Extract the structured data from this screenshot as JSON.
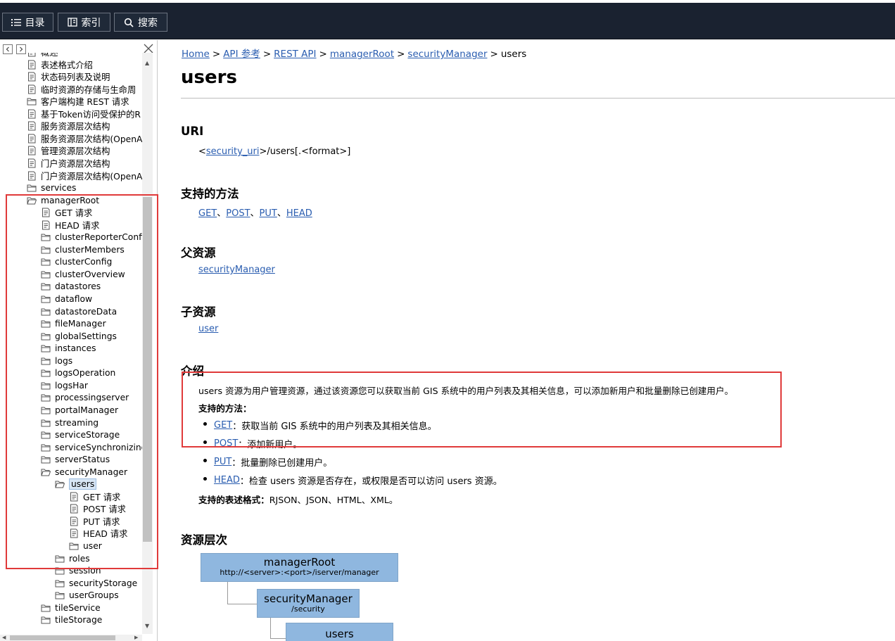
{
  "toolbar": {
    "buttons": [
      {
        "label": "目录",
        "icon": "list-icon"
      },
      {
        "label": "索引",
        "icon": "index-icon"
      },
      {
        "label": "搜索",
        "icon": "search-icon"
      }
    ]
  },
  "tree": {
    "items": [
      {
        "label": "概述",
        "type": "doc",
        "level": 0
      },
      {
        "label": "表述格式介绍",
        "type": "doc",
        "level": 0
      },
      {
        "label": "状态码列表及说明",
        "type": "doc",
        "level": 0
      },
      {
        "label": "临时资源的存储与生命周",
        "type": "doc",
        "level": 0
      },
      {
        "label": "客户端构建 REST 请求",
        "type": "folder",
        "level": 0
      },
      {
        "label": "基于Token访问受保护的R",
        "type": "doc",
        "level": 0
      },
      {
        "label": "服务资源层次结构",
        "type": "doc",
        "level": 0
      },
      {
        "label": "服务资源层次结构(OpenA",
        "type": "doc",
        "level": 0
      },
      {
        "label": "管理资源层次结构",
        "type": "doc",
        "level": 0
      },
      {
        "label": "门户资源层次结构",
        "type": "doc",
        "level": 0
      },
      {
        "label": "门户资源层次结构(OpenA",
        "type": "doc",
        "level": 0
      },
      {
        "label": "services",
        "type": "folder",
        "level": 0
      },
      {
        "label": "managerRoot",
        "type": "folder-open",
        "level": 0
      },
      {
        "label": "GET 请求",
        "type": "doc",
        "level": 1
      },
      {
        "label": "HEAD 请求",
        "type": "doc",
        "level": 1
      },
      {
        "label": "clusterReporterConfig",
        "type": "folder",
        "level": 1
      },
      {
        "label": "clusterMembers",
        "type": "folder",
        "level": 1
      },
      {
        "label": "clusterConfig",
        "type": "folder",
        "level": 1
      },
      {
        "label": "clusterOverview",
        "type": "folder",
        "level": 1
      },
      {
        "label": "datastores",
        "type": "folder",
        "level": 1
      },
      {
        "label": "dataflow",
        "type": "folder",
        "level": 1
      },
      {
        "label": "datastoreData",
        "type": "folder",
        "level": 1
      },
      {
        "label": "fileManager",
        "type": "folder",
        "level": 1
      },
      {
        "label": "globalSettings",
        "type": "folder",
        "level": 1
      },
      {
        "label": "instances",
        "type": "folder",
        "level": 1
      },
      {
        "label": "logs",
        "type": "folder",
        "level": 1
      },
      {
        "label": "logsOperation",
        "type": "folder",
        "level": 1
      },
      {
        "label": "logsHar",
        "type": "folder",
        "level": 1
      },
      {
        "label": "processingserver",
        "type": "folder",
        "level": 1
      },
      {
        "label": "portalManager",
        "type": "folder",
        "level": 1
      },
      {
        "label": "streaming",
        "type": "folder",
        "level": 1
      },
      {
        "label": "serviceStorage",
        "type": "folder",
        "level": 1
      },
      {
        "label": "serviceSynchronizingJ",
        "type": "folder",
        "level": 1
      },
      {
        "label": "serverStatus",
        "type": "folder",
        "level": 1
      },
      {
        "label": "securityManager",
        "type": "folder-open",
        "level": 1
      },
      {
        "label": "users",
        "type": "folder-open",
        "level": 2,
        "selected": true
      },
      {
        "label": "GET 请求",
        "type": "doc",
        "level": 3
      },
      {
        "label": "POST 请求",
        "type": "doc",
        "level": 3
      },
      {
        "label": "PUT 请求",
        "type": "doc",
        "level": 3
      },
      {
        "label": "HEAD 请求",
        "type": "doc",
        "level": 3
      },
      {
        "label": "user",
        "type": "folder",
        "level": 3
      },
      {
        "label": "roles",
        "type": "folder",
        "level": 2
      },
      {
        "label": "session",
        "type": "folder",
        "level": 2
      },
      {
        "label": "securityStorage",
        "type": "folder",
        "level": 2
      },
      {
        "label": "userGroups",
        "type": "folder",
        "level": 2
      },
      {
        "label": "tileService",
        "type": "folder",
        "level": 1
      },
      {
        "label": "tileStorage",
        "type": "folder",
        "level": 1
      }
    ]
  },
  "breadcrumb": {
    "links": [
      "Home",
      "API 参考",
      "REST API",
      "managerRoot",
      "securityManager"
    ],
    "current": "users"
  },
  "page": {
    "title": "users",
    "uri": {
      "heading": "URI",
      "prefix": "<",
      "link": "security_uri",
      "suffix": ">/users[.<format>]"
    },
    "methods": {
      "heading": "支持的方法",
      "links": [
        "GET",
        "POST",
        "PUT",
        "HEAD"
      ],
      "separator": "、"
    },
    "parent": {
      "heading": "父资源",
      "link": "securityManager"
    },
    "children": {
      "heading": "子资源",
      "link": "user"
    },
    "intro": {
      "heading": "介绍",
      "text": "users 资源为用户管理资源，通过该资源您可以获取当前 GIS 系统中的用户列表及其相关信息，可以添加新用户和批量删除已创建用户。",
      "methods_label": "支持的方法：",
      "bullets": [
        {
          "method": "GET",
          "desc": "：获取当前 GIS 系统中的用户列表及其相关信息。"
        },
        {
          "method": "POST",
          "desc": "：添加新用户。"
        },
        {
          "method": "PUT",
          "desc": "：批量删除已创建用户。"
        },
        {
          "method": "HEAD",
          "desc": "：检查 users 资源是否存在，或权限是否可以访问 users 资源。"
        }
      ],
      "formats_label": "支持的表述格式：",
      "formats": "RJSON、JSON、HTML、XML。"
    },
    "hierarchy": {
      "heading": "资源层次",
      "nodes": [
        {
          "main": "managerRoot",
          "sub": "http://<server>:<port>/iserver/manager"
        },
        {
          "main": "securityManager",
          "sub": "/security"
        },
        {
          "main": "users",
          "sub": ""
        }
      ]
    }
  },
  "colors": {
    "toolbar_bg": "#1a2230",
    "link": "#2a5db0",
    "highlight": "#e03a3a",
    "diagram_box": "#8fb7df"
  }
}
